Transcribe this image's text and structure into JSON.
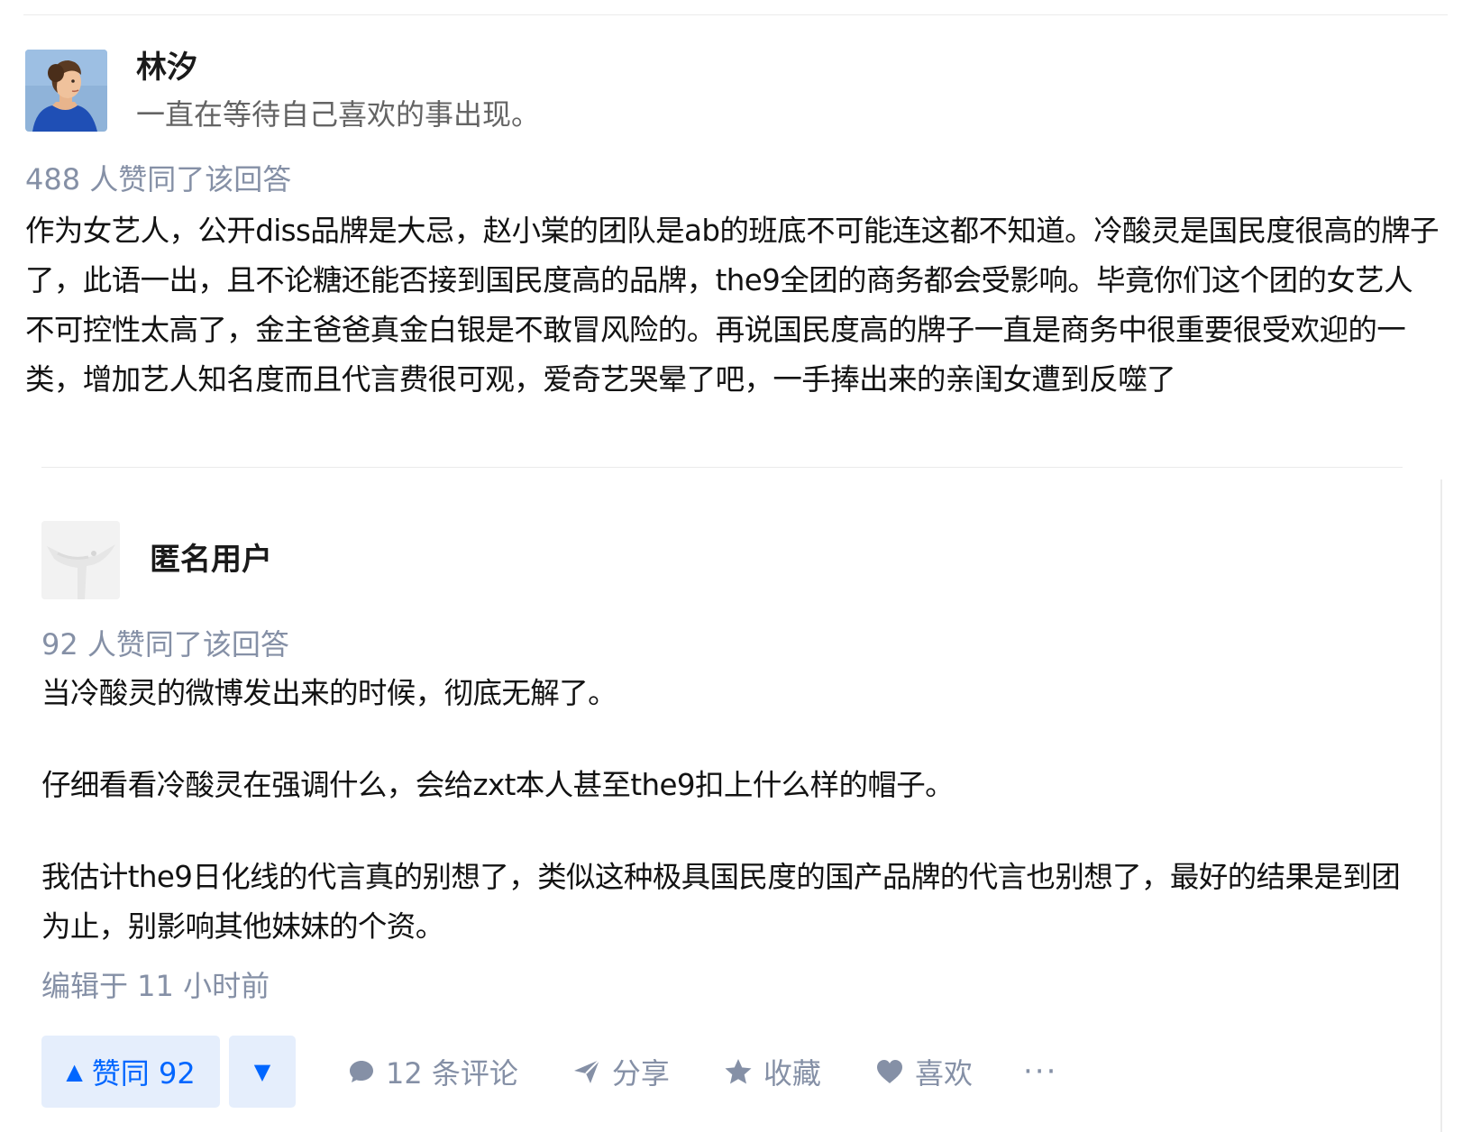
{
  "answer1": {
    "author_name": "林汐",
    "author_bio": "一直在等待自己喜欢的事出现。",
    "vote_summary": "488 人赞同了该回答",
    "content": "作为女艺人，公开diss品牌是大忌，赵小棠的团队是ab的班底不可能连这都不知道。冷酸灵是国民度很高的牌子了，此语一出，且不论糖还能否接到国民度高的品牌，the9全团的商务都会受影响。毕竟你们这个团的女艺人不可控性太高了，金主爸爸真金白银是不敢冒风险的。再说国民度高的牌子一直是商务中很重要很受欢迎的一类，增加艺人知名度而且代言费很可观，爱奇艺哭晕了吧，一手捧出来的亲闺女遭到反噬了"
  },
  "answer2": {
    "author_name": "匿名用户",
    "vote_summary": "92 人赞同了该回答",
    "paragraphs": [
      "当冷酸灵的微博发出来的时候，彻底无解了。",
      "仔细看看冷酸灵在强调什么，会给zxt本人甚至the9扣上什么样的帽子。",
      "我估计the9日化线的代言真的别想了，类似这种极具国民度的国产品牌的代言也别想了，最好的结果是到团为止，别影响其他妹妹的个资。"
    ],
    "edited": "编辑于 11 小时前",
    "actions": {
      "vote_up_arrow": "▲",
      "vote_up_label": "赞同 92",
      "vote_down_arrow": "▼",
      "comments": "12 条评论",
      "share": "分享",
      "favorite": "收藏",
      "like": "喜欢",
      "more": "···"
    }
  },
  "colors": {
    "accent": "#0066ff",
    "accent_bg": "#e5eefc",
    "meta_gray": "#8590a6",
    "bio_gray": "#646464"
  },
  "icons": [
    "avatar-portrait",
    "anonymous-avatar",
    "comment-icon",
    "share-icon",
    "star-icon",
    "heart-icon",
    "more-icon"
  ]
}
